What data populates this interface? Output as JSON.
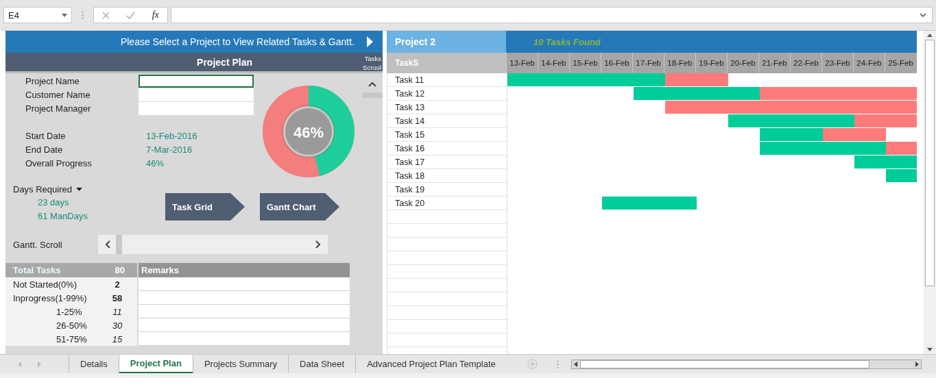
{
  "formula_bar": {
    "name_box": "E4",
    "function_label": "fx"
  },
  "banner": {
    "text": "Please Select a Project to View Related Tasks & Gantt."
  },
  "panel": {
    "title": "Project Plan",
    "fields": [
      {
        "label": "Project Name",
        "selected": true
      },
      {
        "label": "Customer Name",
        "selected": false
      },
      {
        "label": "Project Manager",
        "selected": false
      }
    ],
    "dates": [
      {
        "label": "Start Date",
        "value": "13-Feb-2016"
      },
      {
        "label": "End Date",
        "value": "7-Mar-2016"
      },
      {
        "label": "Overall Progress",
        "value": "46%"
      }
    ],
    "progress": {
      "label": "46%",
      "level": 0.46
    },
    "days_required": {
      "label": "Days Required",
      "values": [
        "23 days",
        "61 ManDays"
      ]
    },
    "buttons": [
      "Task Grid",
      "Gantt Chart"
    ],
    "gantt_scroll": {
      "label": "Gantt. Scroll"
    },
    "summary": {
      "label": "Total Tasks",
      "count": "80",
      "remarks": "Remarks",
      "rows": [
        {
          "kind": "status",
          "label": "Not Started(0%)",
          "count": "2"
        },
        {
          "kind": "status",
          "label": "Inprogress(1-99%)",
          "count": "58"
        },
        {
          "kind": "range",
          "label": "1-25%",
          "count": "11"
        },
        {
          "kind": "range",
          "label": "26-50%",
          "count": "30"
        },
        {
          "kind": "range",
          "label": "51-75%",
          "count": "15"
        }
      ]
    }
  },
  "task_scroll": {
    "label": "Tasks Scrool"
  },
  "gantt": {
    "project": "Project 2",
    "found": "10 Tasks Found",
    "column_header": "TaskS",
    "dates": [
      "13-Feb",
      "14-Feb",
      "15-Feb",
      "16-Feb",
      "17-Feb",
      "18-Feb",
      "19-Feb",
      "20-Feb",
      "21-Feb",
      "22-Feb",
      "23-Feb",
      "24-Feb",
      "25-Feb"
    ],
    "tasks": [
      {
        "name": "Task 11",
        "days": [
          {
            "kind": "done"
          },
          {
            "kind": "done"
          },
          {
            "kind": "done"
          },
          {
            "kind": "done"
          },
          {
            "kind": "done"
          },
          {
            "kind": "remaining"
          },
          {
            "kind": "remaining"
          },
          {
            "kind": "blank"
          },
          {
            "kind": "blank"
          },
          {
            "kind": "blank"
          },
          {
            "kind": "blank"
          },
          {
            "kind": "blank"
          },
          {
            "kind": "blank"
          }
        ]
      },
      {
        "name": "Task 12",
        "days": [
          {
            "kind": "blank"
          },
          {
            "kind": "blank"
          },
          {
            "kind": "blank"
          },
          {
            "kind": "blank"
          },
          {
            "kind": "done"
          },
          {
            "kind": "done"
          },
          {
            "kind": "done"
          },
          {
            "kind": "done"
          },
          {
            "kind": "remaining"
          },
          {
            "kind": "remaining"
          },
          {
            "kind": "remaining"
          },
          {
            "kind": "remaining"
          },
          {
            "kind": "remaining"
          }
        ]
      },
      {
        "name": "Task 13",
        "days": [
          {
            "kind": "blank"
          },
          {
            "kind": "blank"
          },
          {
            "kind": "blank"
          },
          {
            "kind": "blank"
          },
          {
            "kind": "blank"
          },
          {
            "kind": "remaining"
          },
          {
            "kind": "remaining"
          },
          {
            "kind": "remaining"
          },
          {
            "kind": "remaining"
          },
          {
            "kind": "remaining"
          },
          {
            "kind": "remaining"
          },
          {
            "kind": "remaining"
          },
          {
            "kind": "remaining"
          }
        ]
      },
      {
        "name": "Task 14",
        "days": [
          {
            "kind": "blank"
          },
          {
            "kind": "blank"
          },
          {
            "kind": "blank"
          },
          {
            "kind": "blank"
          },
          {
            "kind": "blank"
          },
          {
            "kind": "blank"
          },
          {
            "kind": "blank"
          },
          {
            "kind": "done"
          },
          {
            "kind": "done"
          },
          {
            "kind": "done"
          },
          {
            "kind": "done"
          },
          {
            "kind": "remaining"
          },
          {
            "kind": "remaining"
          }
        ]
      },
      {
        "name": "Task 15",
        "days": [
          {
            "kind": "blank"
          },
          {
            "kind": "blank"
          },
          {
            "kind": "blank"
          },
          {
            "kind": "blank"
          },
          {
            "kind": "blank"
          },
          {
            "kind": "blank"
          },
          {
            "kind": "blank"
          },
          {
            "kind": "blank"
          },
          {
            "kind": "done"
          },
          {
            "kind": "done"
          },
          {
            "kind": "remaining"
          },
          {
            "kind": "remaining"
          },
          {
            "kind": "blank"
          }
        ]
      },
      {
        "name": "Task 16",
        "days": [
          {
            "kind": "blank"
          },
          {
            "kind": "blank"
          },
          {
            "kind": "blank"
          },
          {
            "kind": "blank"
          },
          {
            "kind": "blank"
          },
          {
            "kind": "blank"
          },
          {
            "kind": "blank"
          },
          {
            "kind": "blank"
          },
          {
            "kind": "done"
          },
          {
            "kind": "done"
          },
          {
            "kind": "done"
          },
          {
            "kind": "done"
          },
          {
            "kind": "remaining"
          }
        ]
      },
      {
        "name": "Task 17",
        "days": [
          {
            "kind": "blank"
          },
          {
            "kind": "blank"
          },
          {
            "kind": "blank"
          },
          {
            "kind": "blank"
          },
          {
            "kind": "blank"
          },
          {
            "kind": "blank"
          },
          {
            "kind": "blank"
          },
          {
            "kind": "blank"
          },
          {
            "kind": "blank"
          },
          {
            "kind": "blank"
          },
          {
            "kind": "blank"
          },
          {
            "kind": "done"
          },
          {
            "kind": "done"
          }
        ]
      },
      {
        "name": "Task 18",
        "days": [
          {
            "kind": "blank"
          },
          {
            "kind": "blank"
          },
          {
            "kind": "blank"
          },
          {
            "kind": "blank"
          },
          {
            "kind": "blank"
          },
          {
            "kind": "blank"
          },
          {
            "kind": "blank"
          },
          {
            "kind": "blank"
          },
          {
            "kind": "blank"
          },
          {
            "kind": "blank"
          },
          {
            "kind": "blank"
          },
          {
            "kind": "blank"
          },
          {
            "kind": "done"
          }
        ]
      },
      {
        "name": "Task 19",
        "days": [
          {
            "kind": "blank"
          },
          {
            "kind": "blank"
          },
          {
            "kind": "blank"
          },
          {
            "kind": "blank"
          },
          {
            "kind": "blank"
          },
          {
            "kind": "blank"
          },
          {
            "kind": "blank"
          },
          {
            "kind": "blank"
          },
          {
            "kind": "blank"
          },
          {
            "kind": "blank"
          },
          {
            "kind": "blank"
          },
          {
            "kind": "blank"
          },
          {
            "kind": "blank"
          }
        ]
      },
      {
        "name": "Task 20",
        "days": [
          {
            "kind": "blank"
          },
          {
            "kind": "blank"
          },
          {
            "kind": "blank"
          },
          {
            "kind": "done"
          },
          {
            "kind": "done"
          },
          {
            "kind": "done"
          },
          {
            "kind": "blank"
          },
          {
            "kind": "blank"
          },
          {
            "kind": "blank"
          },
          {
            "kind": "blank"
          },
          {
            "kind": "blank"
          },
          {
            "kind": "blank"
          },
          {
            "kind": "blank"
          }
        ]
      }
    ]
  },
  "sheet_tabs": [
    {
      "label": "Details",
      "selected": false
    },
    {
      "label": "Project Plan",
      "selected": true
    },
    {
      "label": "Projects Summary",
      "selected": false
    },
    {
      "label": "Data Sheet",
      "selected": false
    },
    {
      "label": "Advanced Project Plan Template",
      "selected": false
    }
  ]
}
